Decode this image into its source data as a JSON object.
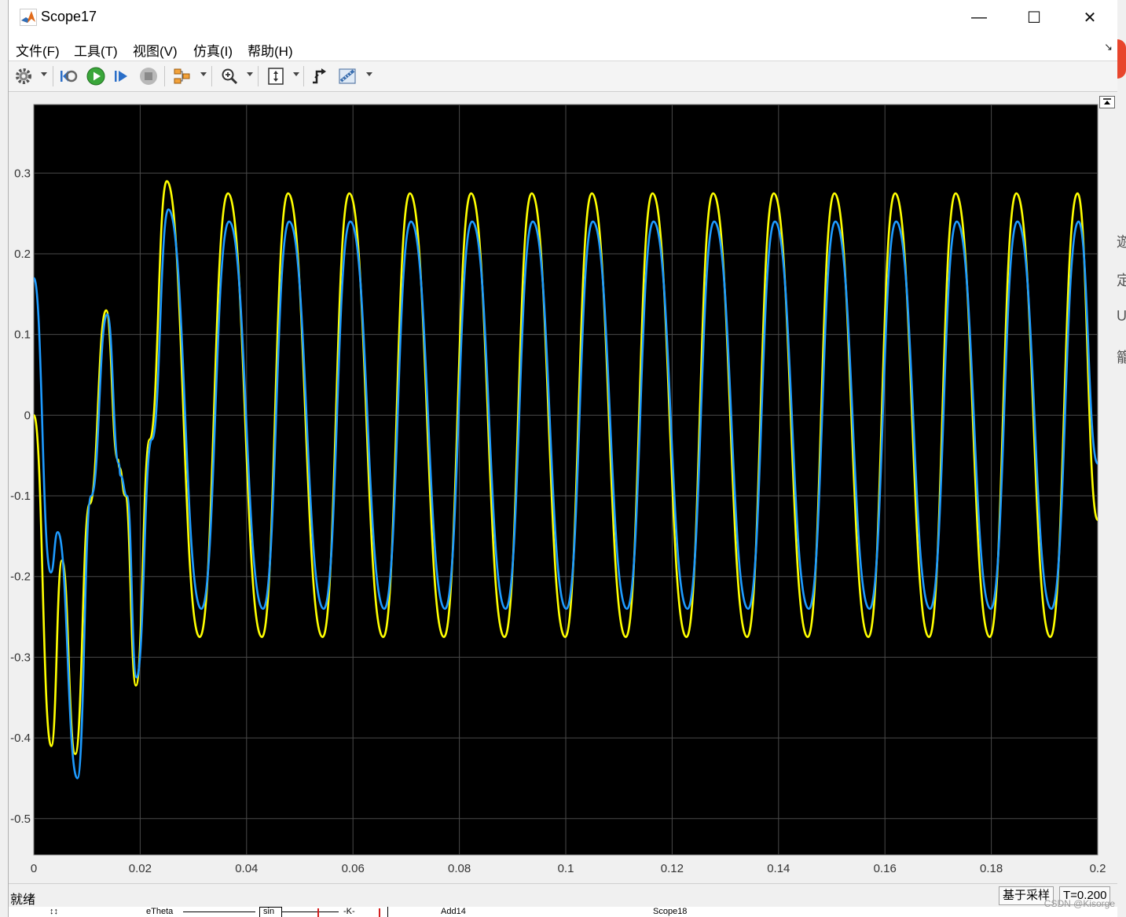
{
  "window": {
    "title": "Scope17"
  },
  "titlebar_buttons": {
    "minimize": "—",
    "maximize": "☐",
    "close": "✕"
  },
  "menu": [
    "文件(F)",
    "工具(T)",
    "视图(V)",
    "仿真(I)",
    "帮助(H)"
  ],
  "menu_collapse_glyph": "↘",
  "toolbar": {
    "icons": [
      "settings-icon",
      "step-back-icon",
      "run-icon",
      "step-forward-icon",
      "stop-icon",
      "highlight-icon",
      "zoom-in-icon",
      "autoscale-icon",
      "triggers-icon",
      "measurements-icon"
    ]
  },
  "status": {
    "text": "就绪",
    "sample_mode": "基于采样",
    "time": "T=0.200"
  },
  "bottom_strip": [
    "eTheta",
    "sin",
    "-K-",
    "Add14",
    "Scope18"
  ],
  "watermark": "CSDN @Kisorge",
  "right_edge_glyphs": [
    "遊",
    "定",
    "U",
    "籠"
  ],
  "colors": {
    "plot_bg": "#000000",
    "grid": "#4a4a4a",
    "series1": "#ffff00",
    "series2": "#1e9bff",
    "axis_text": "#ffffff"
  },
  "chart_data": {
    "type": "line",
    "xlim": [
      0,
      0.2
    ],
    "ylim": [
      -0.545,
      0.385
    ],
    "xticks": [
      0,
      0.02,
      0.04,
      0.06,
      0.08,
      0.1,
      0.12,
      0.14,
      0.16,
      0.18,
      0.2
    ],
    "xtick_labels": [
      "0",
      "0.02",
      "0.04",
      "0.06",
      "0.08",
      "0.1",
      "0.12",
      "0.14",
      "0.16",
      "0.18",
      "0.2"
    ],
    "yticks": [
      -0.5,
      -0.4,
      -0.3,
      -0.2,
      -0.1,
      0,
      0.1,
      0.2,
      0.3
    ],
    "ytick_labels": [
      "-0.5",
      "-0.4",
      "-0.3",
      "-0.2",
      "-0.1",
      "0",
      "0.1",
      "0.2",
      "0.3"
    ],
    "grid": true,
    "series": [
      {
        "color": "#ffff00",
        "x": [
          0,
          0.0033,
          0.0053,
          0.0078,
          0.0105,
          0.0136,
          0.0158,
          0.0161,
          0.0172,
          0.0192,
          0.0218,
          0.025,
          0.0312,
          0.0365,
          0.0429,
          0.0478,
          0.0543,
          0.0593,
          0.0657,
          0.0707,
          0.0771,
          0.0822,
          0.0885,
          0.0936,
          0.0999,
          0.1049,
          0.1113,
          0.1163,
          0.1227,
          0.1277,
          0.1341,
          0.1391,
          0.1455,
          0.1505,
          0.1569,
          0.1619,
          0.1683,
          0.1733,
          0.1797,
          0.1847,
          0.1911,
          0.1962,
          0.2
        ],
        "y": [
          0,
          -0.41,
          -0.18,
          -0.42,
          -0.11,
          0.13,
          -0.055,
          -0.065,
          -0.1,
          -0.335,
          -0.03,
          0.29,
          -0.275,
          0.275,
          -0.275,
          0.275,
          -0.275,
          0.275,
          -0.275,
          0.275,
          -0.275,
          0.275,
          -0.275,
          0.275,
          -0.275,
          0.275,
          -0.275,
          0.275,
          -0.275,
          0.275,
          -0.275,
          0.275,
          -0.275,
          0.275,
          -0.275,
          0.275,
          -0.275,
          0.275,
          -0.275,
          0.275,
          -0.275,
          0.275,
          -0.13
        ]
      },
      {
        "color": "#1e9bff",
        "x": [
          0,
          0.0032,
          0.0045,
          0.0082,
          0.0108,
          0.0138,
          0.016,
          0.0163,
          0.0175,
          0.0193,
          0.0222,
          0.0253,
          0.0315,
          0.0367,
          0.0431,
          0.048,
          0.0545,
          0.0595,
          0.0659,
          0.0709,
          0.0773,
          0.0824,
          0.0887,
          0.0938,
          0.1001,
          0.1051,
          0.1115,
          0.1165,
          0.1229,
          0.1279,
          0.1343,
          0.1393,
          0.1457,
          0.1507,
          0.1571,
          0.1621,
          0.1685,
          0.1735,
          0.1799,
          0.1849,
          0.1913,
          0.1964,
          0.2
        ],
        "y": [
          0.17,
          -0.195,
          -0.145,
          -0.45,
          -0.1,
          0.125,
          -0.06,
          -0.075,
          -0.1,
          -0.325,
          -0.03,
          0.255,
          -0.24,
          0.24,
          -0.24,
          0.24,
          -0.24,
          0.24,
          -0.24,
          0.24,
          -0.24,
          0.24,
          -0.24,
          0.24,
          -0.24,
          0.24,
          -0.24,
          0.24,
          -0.24,
          0.24,
          -0.24,
          0.24,
          -0.24,
          0.24,
          -0.24,
          0.24,
          -0.24,
          0.24,
          -0.24,
          0.24,
          -0.24,
          0.24,
          -0.06
        ]
      }
    ]
  }
}
